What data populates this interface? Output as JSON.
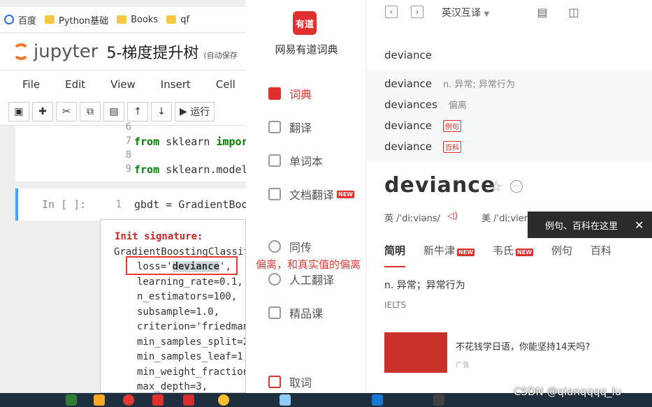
{
  "browser": {
    "bookmarks": [
      "百度",
      "Python基础",
      "Books",
      "qf"
    ]
  },
  "jupyter": {
    "brand": "jupyter",
    "notebook_title": "5-梯度提升树",
    "autosave": "(自动保存",
    "menu": [
      "File",
      "Edit",
      "View",
      "Insert",
      "Cell"
    ],
    "run_label": "运行",
    "cell1_lines": [
      {
        "no": "6",
        "code": ""
      },
      {
        "no": "7",
        "kw": "from",
        "rest": " sklearn ",
        "kw2": "impor"
      },
      {
        "no": "8",
        "code": ""
      },
      {
        "no": "9",
        "kw": "from",
        "rest": " sklearn.model_"
      }
    ],
    "cell2_prompt": "In [ ]:",
    "cell2_no": "1",
    "cell2_code": "gbdt = GradientBoos",
    "tooltip": {
      "header": "Init signature:",
      "cls": "GradientBoostingClassifi",
      "loss_pre": "loss='",
      "loss_val": "deviance",
      "loss_post": "',",
      "params": [
        "learning_rate=0.1,",
        "n_estimators=100,",
        "subsample=1.0,",
        "criterion='friedman",
        "min_samples_split=2,",
        "min_samples_leaf=1,",
        "min_weight_fraction_",
        "max_depth=3,"
      ]
    },
    "annotation": "偏离，和真实值的偏离"
  },
  "dict_app": {
    "logo": "有道",
    "name": "网易有道词典",
    "nav": [
      {
        "label": "词典",
        "active": true
      },
      {
        "label": "翻译"
      },
      {
        "label": "单词本"
      },
      {
        "label": "文档翻译",
        "badge": "NEW"
      },
      {
        "label": "同传"
      },
      {
        "label": "人工翻译"
      },
      {
        "label": "精品课"
      },
      {
        "label": "取词"
      }
    ],
    "mode": "英汉互译",
    "search": "deviance",
    "suggestions": [
      {
        "word": "deviance",
        "desc": "n. 异常; 异常行为"
      },
      {
        "word": "deviances",
        "desc": "偏离"
      },
      {
        "word": "deviance",
        "tag": "例句"
      },
      {
        "word": "deviance",
        "tag": "百科"
      }
    ],
    "headword": "deviance",
    "phonetic_uk": "英 /ˈdiːviəns/",
    "phonetic_us": "美 /ˈdiːvien",
    "tip": "例句、百科在这里",
    "tabs": [
      "简明",
      "新牛津",
      "韦氏",
      "例句",
      "百科"
    ],
    "new_badge": "NEW",
    "definition": "n. 异常；异常行为",
    "exam": "IELTS",
    "ad_text": "不花钱学日语，你能坚持14天吗?",
    "ad_label": "广告"
  },
  "watermark": "CSDN @qianqqqq_lu"
}
